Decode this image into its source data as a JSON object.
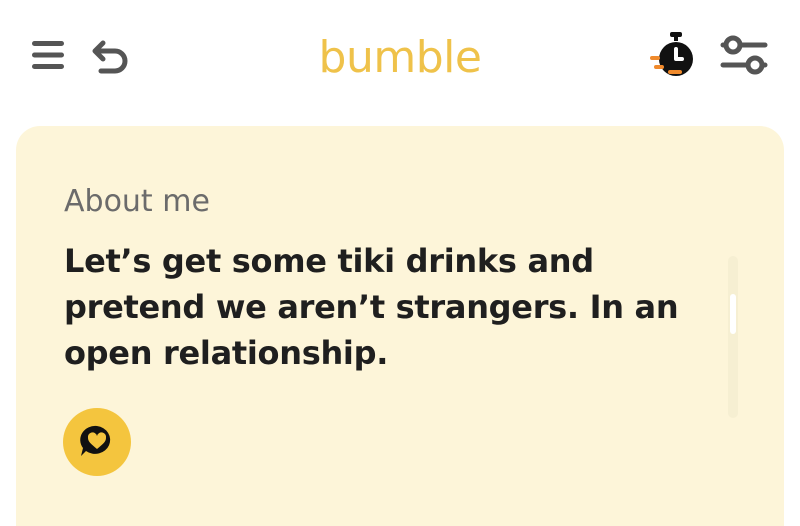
{
  "header": {
    "logo_text": "bumble",
    "icons": {
      "menu": "menu-icon",
      "undo": "undo-icon",
      "timer": "stopwatch-icon",
      "filter": "filter-sliders-icon"
    }
  },
  "profile_card": {
    "heading": "About me",
    "bio": "Let’s get some tiki drinks and pretend we aren’t strangers. In an open relationship.",
    "action_icon": "compliment-heart-bubble-icon"
  },
  "colors": {
    "brand": "#efc24a",
    "card_background": "#fdf5d9",
    "accent_orange": "#f08a2c",
    "text_dark": "#1f1f1f",
    "text_muted": "#6b6b6b"
  }
}
